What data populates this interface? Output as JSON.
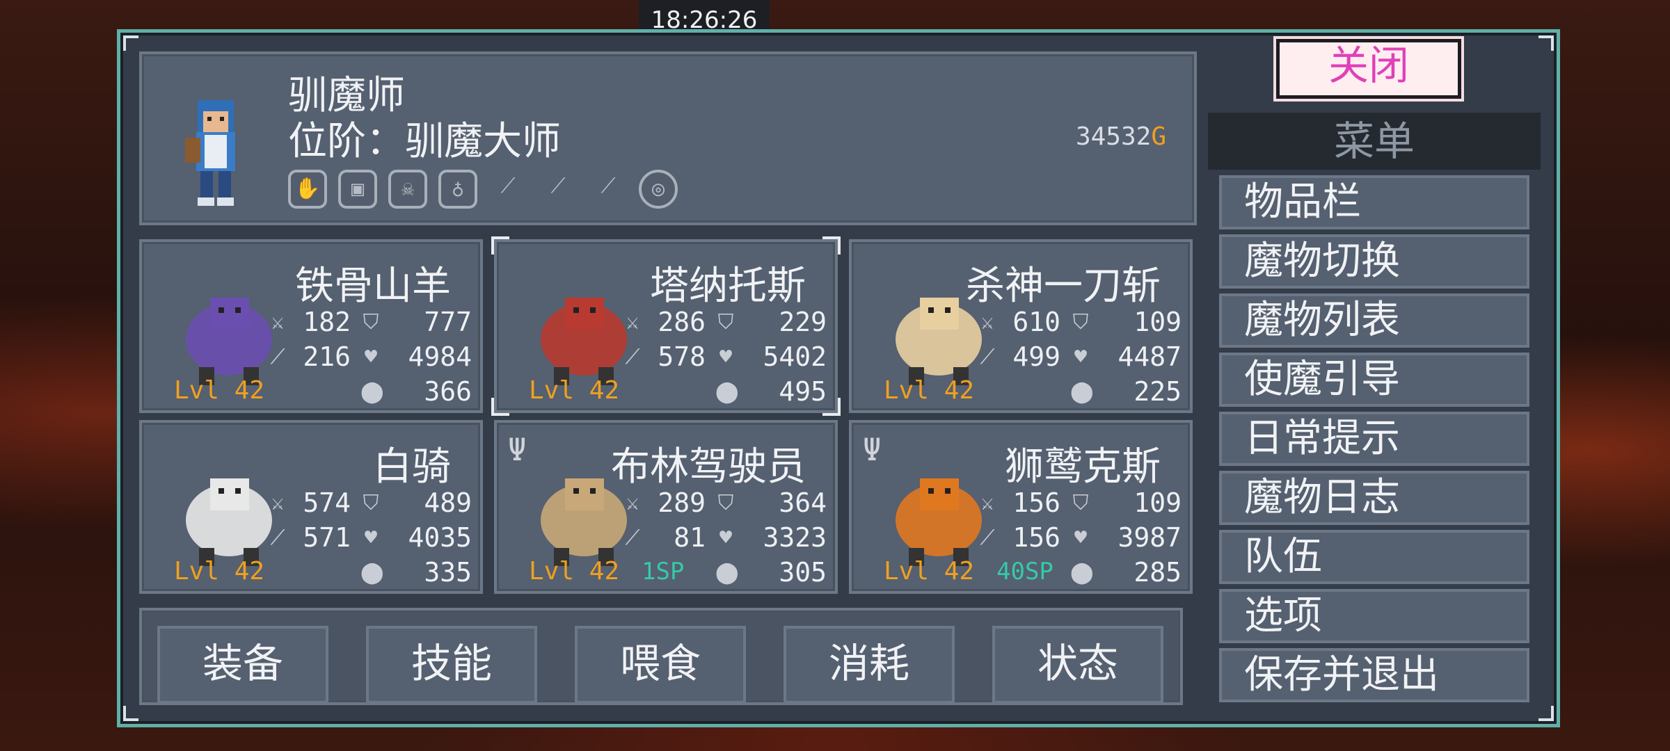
{
  "clock": "18:26:26",
  "close_label": "关闭",
  "hero": {
    "name": "驯魔师",
    "rank": "位阶：驯魔大师",
    "gold_amount": "34532",
    "gold_unit": "G",
    "equipment_icons": [
      "claw-icon",
      "armor-icon",
      "skull-icon",
      "amulet-icon",
      "feather-icon",
      "feather-icon",
      "feather-icon",
      "egg-icon"
    ]
  },
  "monsters": [
    {
      "name": "铁骨山羊",
      "atk": "182",
      "def": "777",
      "matk": "216",
      "hp": "4984",
      "mana": "366",
      "level": "Lvl 42",
      "sp": "",
      "fork": false,
      "color": "#6a4fb0"
    },
    {
      "name": "塔纳托斯",
      "atk": "286",
      "def": "229",
      "matk": "578",
      "hp": "5402",
      "mana": "495",
      "level": "Lvl 42",
      "sp": "",
      "fork": false,
      "color": "#b83a30"
    },
    {
      "name": "杀神一刀斩",
      "atk": "610",
      "def": "109",
      "matk": "499",
      "hp": "4487",
      "mana": "225",
      "level": "Lvl 42",
      "sp": "",
      "fork": false,
      "color": "#e8cfa0"
    },
    {
      "name": "白骑",
      "atk": "574",
      "def": "489",
      "matk": "571",
      "hp": "4035",
      "mana": "335",
      "level": "Lvl 42",
      "sp": "",
      "fork": false,
      "color": "#e8e8e8"
    },
    {
      "name": "布林驾驶员",
      "atk": "289",
      "def": "364",
      "matk": "81",
      "hp": "3323",
      "mana": "305",
      "level": "Lvl 42",
      "sp": "1SP",
      "fork": true,
      "color": "#c8a878"
    },
    {
      "name": "狮鹫克斯",
      "atk": "156",
      "def": "109",
      "matk": "156",
      "hp": "3987",
      "mana": "285",
      "level": "Lvl 42",
      "sp": "40SP",
      "fork": true,
      "color": "#e07820"
    }
  ],
  "actions": [
    "装备",
    "技能",
    "喂食",
    "消耗",
    "状态"
  ],
  "menu": {
    "title": "菜单",
    "items": [
      "物品栏",
      "魔物切换",
      "魔物列表",
      "使魔引导",
      "日常提示",
      "魔物日志",
      "队伍",
      "选项",
      "保存并退出"
    ]
  },
  "colors": {
    "accent_gold": "#f0a020",
    "sp_green": "#36c9a8",
    "close_text": "#e040b8",
    "frame": "#5fb0a8"
  }
}
